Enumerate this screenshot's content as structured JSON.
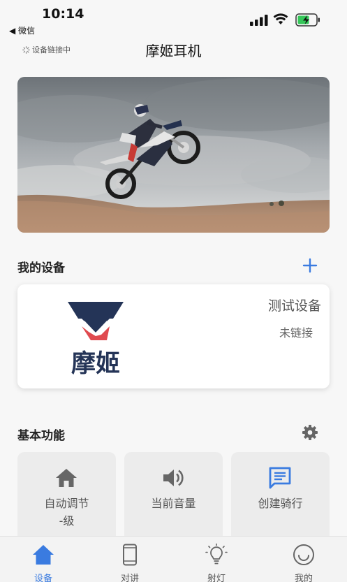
{
  "status_bar": {
    "time": "10:14",
    "back_app": "◀ 微信"
  },
  "nav": {
    "connection_status": "设备链接中",
    "title": "摩姬耳机"
  },
  "my_devices": {
    "section_title": "我的设备",
    "device": {
      "name": "测试设备",
      "status": "未链接",
      "brand_text": "摩姬"
    }
  },
  "basic_functions": {
    "section_title": "基本功能",
    "items": [
      {
        "label": "自动调节",
        "label2": "-级",
        "icon": "home-icon"
      },
      {
        "label": "当前音量",
        "icon": "volume-icon"
      },
      {
        "label": "创建骑行",
        "icon": "message-icon"
      }
    ]
  },
  "tabbar": {
    "items": [
      {
        "label": "设备",
        "icon": "home-icon",
        "active": true
      },
      {
        "label": "对讲",
        "icon": "phone-icon"
      },
      {
        "label": "射灯",
        "icon": "light-bulb-icon"
      },
      {
        "label": "我的",
        "icon": "smile-icon"
      }
    ]
  },
  "colors": {
    "accent": "#3a7be0",
    "logo_navy": "#243457",
    "logo_red": "#e04a4f",
    "icon_gray": "#666666"
  }
}
